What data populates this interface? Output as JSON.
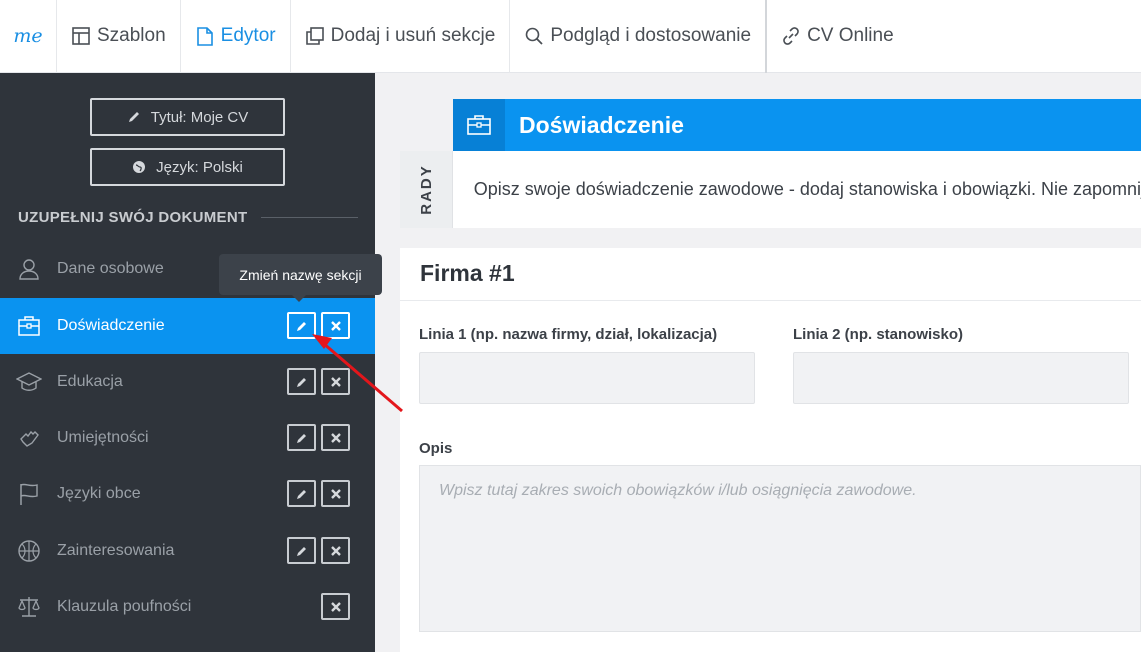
{
  "topbar": {
    "logo": "me",
    "nav": [
      {
        "label": "Szablon",
        "icon": "template-icon"
      },
      {
        "label": "Edytor",
        "icon": "document-icon"
      },
      {
        "label": "Dodaj i usuń sekcje",
        "icon": "copy-icon"
      },
      {
        "label": "Podgląd i dostosowanie",
        "icon": "search-icon"
      },
      {
        "label": "CV Online",
        "icon": "link-icon"
      }
    ]
  },
  "sidebar": {
    "title_button": "Tytuł: Moje CV",
    "language_button": "Język: Polski",
    "section_heading": "UZUPEŁNIJ SWÓJ DOKUMENT",
    "items": [
      {
        "label": "Dane osobowe",
        "icon": "user-icon"
      },
      {
        "label": "Doświadczenie",
        "icon": "briefcase-icon"
      },
      {
        "label": "Edukacja",
        "icon": "graduation-cap-icon"
      },
      {
        "label": "Umiejętności",
        "icon": "hand-icon"
      },
      {
        "label": "Języki obce",
        "icon": "flag-icon"
      },
      {
        "label": "Zainteresowania",
        "icon": "basketball-icon"
      },
      {
        "label": "Klauzula poufności",
        "icon": "scale-icon"
      }
    ],
    "tooltip": "Zmień nazwę sekcji"
  },
  "main": {
    "section_title": "Doświadczenie",
    "tips_tab": "RADY",
    "tips_text": "Opisz swoje doświadczenie zawodowe - dodaj stanowiska i obowiązki. Nie zapomnij",
    "company_title": "Firma #1",
    "line1_label": "Linia 1 (np. nazwa firmy, dział, lokalizacja)",
    "line2_label": "Linia 2 (np. stanowisko)",
    "description_label": "Opis",
    "description_placeholder": "Wpisz tutaj zakres swoich obowiązków i/lub osiągnięcia zawodowe."
  },
  "colors": {
    "accent": "#0a93f0",
    "sidebar_bg": "#2f343b",
    "arrow": "#e3161b"
  }
}
